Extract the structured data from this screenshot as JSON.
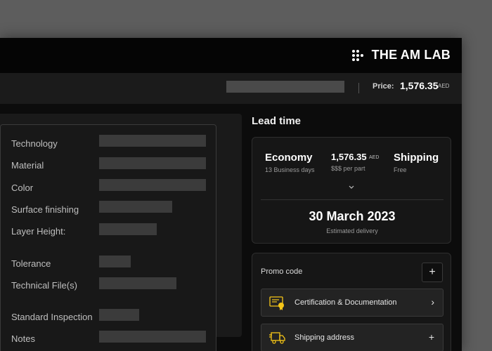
{
  "brand": {
    "name": "THE AM LAB"
  },
  "pricebar": {
    "label": "Price:",
    "value": "1,576.35",
    "currency": "AED"
  },
  "specs": [
    {
      "label": "Technology"
    },
    {
      "label": "Material"
    },
    {
      "label": "Color"
    },
    {
      "label": "Surface finishing"
    },
    {
      "label": "Layer Height:"
    },
    {
      "label": "Tolerance"
    },
    {
      "label": "Technical File(s)"
    },
    {
      "label": "Standard Inspection"
    },
    {
      "label": "Notes"
    }
  ],
  "lead_time": {
    "title": "Lead time",
    "economy": {
      "name": "Economy",
      "days": "13 Business days"
    },
    "price": {
      "value": "1,576.35",
      "currency": "AED",
      "per_part": "$$$ per part"
    },
    "shipping": {
      "name": "Shipping",
      "cost": "Free"
    },
    "delivery_date": "30 March 2023",
    "delivery_label": "Estimated delivery"
  },
  "promo": {
    "label": "Promo code",
    "add_symbol": "+",
    "rows": [
      {
        "label": "Certification & Documentation",
        "action": "›"
      },
      {
        "label": "Shipping address",
        "action": "+"
      }
    ]
  },
  "colors": {
    "accent": "#f5c518",
    "window_bg": "#0c0c0c",
    "bar_bg": "#1b1b1b"
  }
}
